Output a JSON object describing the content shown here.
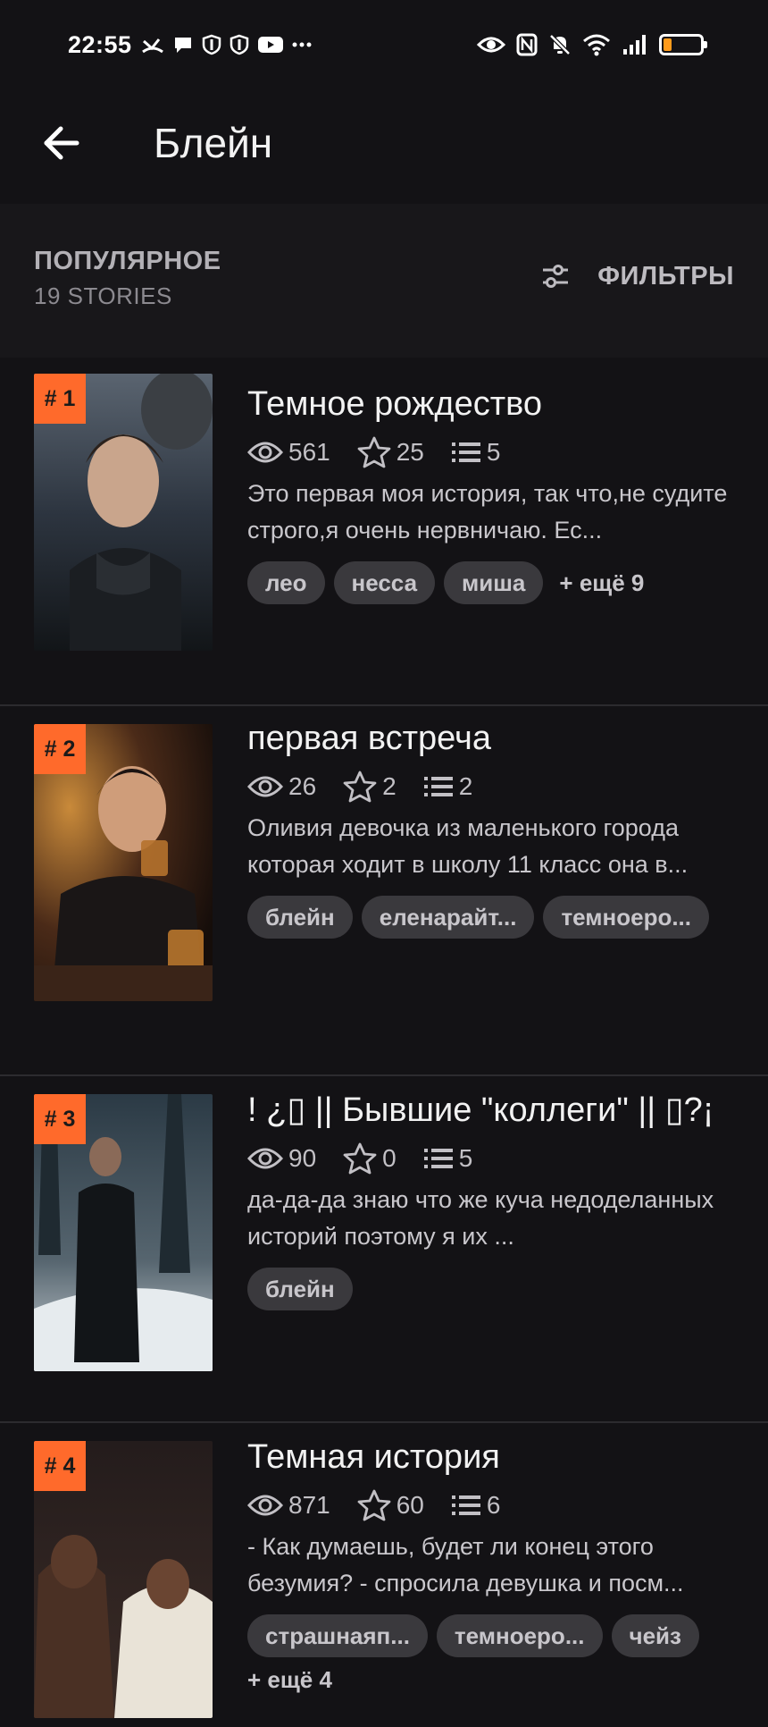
{
  "status": {
    "time": "22:55"
  },
  "header": {
    "title": "Блейн"
  },
  "section": {
    "title": "ПОПУЛЯРНОЕ",
    "count": "19 STORIES",
    "filter_label": "ФИЛЬТРЫ"
  },
  "stories": [
    {
      "rank": "# 1",
      "title": "Темное рождество",
      "views": "561",
      "votes": "25",
      "parts": "5",
      "description": "Это первая моя история, так что,не судите строго,я очень нервничаю. Ес...",
      "tags": [
        "лео",
        "несса",
        "миша"
      ],
      "more": "+ ещё 9"
    },
    {
      "rank": "# 2",
      "title": "первая встреча",
      "views": "26",
      "votes": "2",
      "parts": "2",
      "description": "Оливия девочка из маленького города которая ходит в школу 11 класс она в...",
      "tags": [
        "блейн",
        "еленарайт...",
        "темноеро..."
      ]
    },
    {
      "rank": "# 3",
      "title": "! ¿▯ || Бывшие \"коллеги\" || ▯?¡",
      "views": "90",
      "votes": "0",
      "parts": "5",
      "description": "да-да-да знаю что же куча недоделанных историй поэтому я их ...",
      "tags": [
        "блейн"
      ]
    },
    {
      "rank": "# 4",
      "title": "Темная история",
      "views": "871",
      "votes": "60",
      "parts": "6",
      "description": "- Как думаешь, будет ли конец этого безумия? - спросила девушка и посм...",
      "tags": [
        "страшнаяп...",
        "темноеро...",
        "чейз"
      ],
      "more": "+ ещё 4"
    }
  ]
}
